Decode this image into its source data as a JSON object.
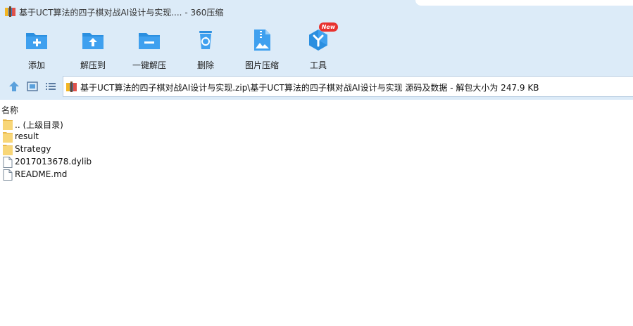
{
  "window": {
    "title": "基于UCT算法的四子棋对战AI设计与实现.... - 360压缩"
  },
  "toolbar": {
    "add_label": "添加",
    "extract_label": "解压到",
    "one_click_label": "一键解压",
    "delete_label": "删除",
    "image_compress_label": "图片压缩",
    "tools_label": "工具",
    "new_badge": "New"
  },
  "nav": {
    "path": "基于UCT算法的四子棋对战AI设计与实现.zip\\基于UCT算法的四子棋对战AI设计与实现 源码及数据 - 解包大小为 247.9 KB"
  },
  "columns": {
    "name": "名称"
  },
  "files": [
    {
      "name": ".. (上级目录)",
      "type": "folder"
    },
    {
      "name": "result",
      "type": "folder"
    },
    {
      "name": "Strategy",
      "type": "folder"
    },
    {
      "name": "2017013678.dylib",
      "type": "file"
    },
    {
      "name": "README.md",
      "type": "file"
    }
  ],
  "colors": {
    "chrome_bg": "#dcebf8",
    "icon_blue": "#2b8fe0",
    "folder_yellow": "#f8d677",
    "badge_red": "#e8322f"
  }
}
